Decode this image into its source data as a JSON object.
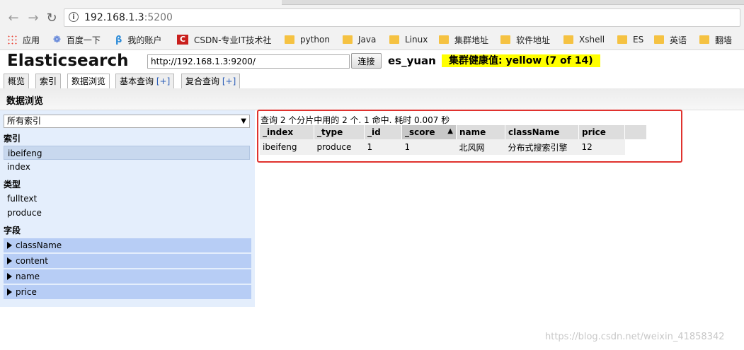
{
  "browser": {
    "url_host": "192.168.1.3",
    "url_port": ":5200",
    "bookmarks": [
      "应用",
      "百度一下",
      "我的账户",
      "CSDN-专业IT技术社",
      "python",
      "Java",
      "Linux",
      "集群地址",
      "软件地址",
      "Xshell",
      "ES",
      "英语",
      "翻墙"
    ]
  },
  "header": {
    "title": "Elasticsearch",
    "url_value": "http://192.168.1.3:9200/",
    "connect_label": "连接",
    "cluster_name": "es_yuan",
    "health": "集群健康值: yellow (7 of 14)"
  },
  "tabs": [
    {
      "label": "概览"
    },
    {
      "label": "索引"
    },
    {
      "label": "数据浏览"
    },
    {
      "label": "基本查询",
      "plus": "[+]"
    },
    {
      "label": "复合查询",
      "plus": "[+]"
    }
  ],
  "section_title": "数据浏览",
  "sidebar": {
    "index_select": "所有索引",
    "indices_heading": "索引",
    "indices": [
      "ibeifeng",
      "index"
    ],
    "types_heading": "类型",
    "types": [
      "fulltext",
      "produce"
    ],
    "fields_heading": "字段",
    "fields": [
      "className",
      "content",
      "name",
      "price"
    ]
  },
  "results": {
    "summary": "查询 2 个分片中用的 2 个. 1 命中. 耗时 0.007 秒",
    "columns": [
      "_index",
      "_type",
      "_id",
      "_score",
      "name",
      "className",
      "price"
    ],
    "sort_indicator": "▲",
    "rows": [
      [
        "ibeifeng",
        "produce",
        "1",
        "1",
        "北风网",
        "分布式搜索引擎",
        "12"
      ]
    ]
  },
  "watermark": "https://blog.csdn.net/weixin_41858342",
  "colors": {
    "health_bg": "#ffff00",
    "highlight_border": "#e0322e",
    "sidebar_bg": "#e4eefc",
    "field_bg": "#b7cdf5"
  }
}
